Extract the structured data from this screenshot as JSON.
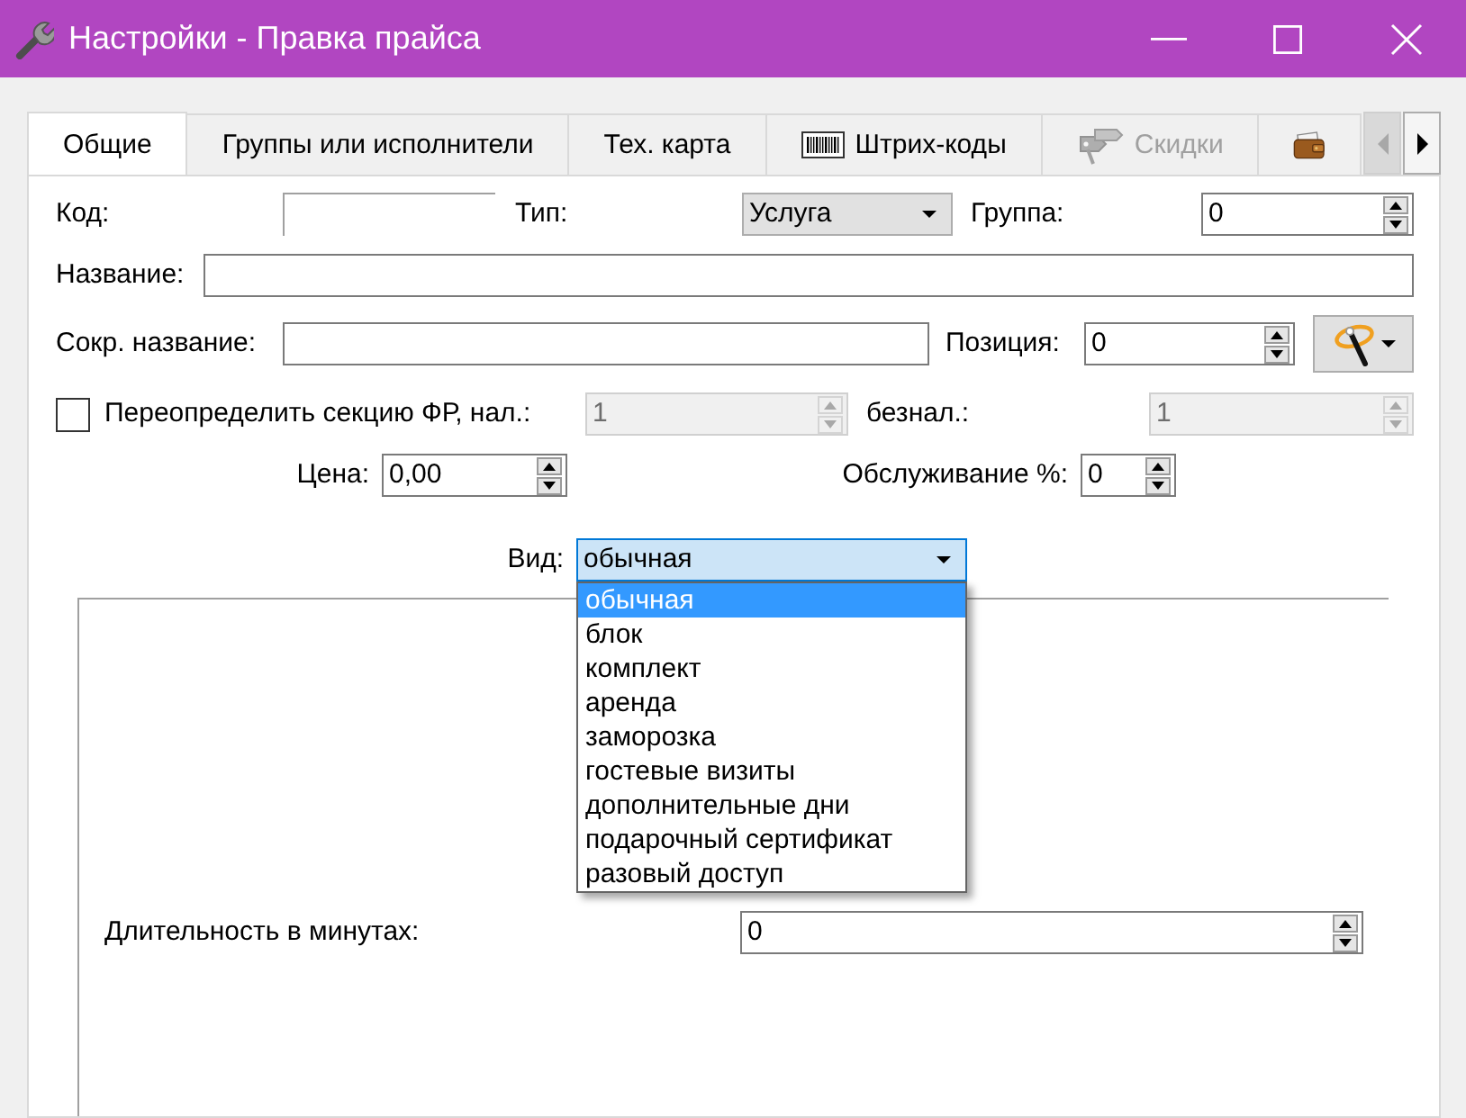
{
  "window": {
    "title": "Настройки - Правка прайса"
  },
  "tabs": [
    {
      "label": "Общие",
      "kind": "text",
      "selected": true,
      "disabled": false
    },
    {
      "label": "Группы или исполнители",
      "kind": "text",
      "selected": false,
      "disabled": false
    },
    {
      "label": "Тех. карта",
      "kind": "text",
      "selected": false,
      "disabled": false
    },
    {
      "label": "Штрих-коды",
      "kind": "barcode",
      "selected": false,
      "disabled": false
    },
    {
      "label": "Скидки",
      "kind": "discount",
      "selected": false,
      "disabled": true
    },
    {
      "kind": "wallet",
      "selected": false,
      "disabled": false
    }
  ],
  "tab_scroll": {
    "back": {
      "disabled": true
    },
    "forward": {
      "disabled": false
    }
  },
  "form": {
    "code": {
      "label": "Код:"
    },
    "type": {
      "label": "Тип:",
      "value": "Услуга"
    },
    "group": {
      "label": "Группа:",
      "value": "0"
    },
    "name": {
      "label": "Название:"
    },
    "short_name": {
      "label": "Сокр. название:"
    },
    "position": {
      "label": "Позиция:",
      "value": "0"
    },
    "override": {
      "label": "Переопределить секцию ФР, нал.:",
      "checked": false
    },
    "cash_section": {
      "value": "1",
      "disabled": true
    },
    "cashless_section": {
      "label": "безнал.:",
      "value": "1",
      "disabled": true
    },
    "price": {
      "label": "Цена:",
      "value": "0,00"
    },
    "service": {
      "label": "Обслуживание %:",
      "value": "0"
    },
    "view_type": {
      "label": "Вид:",
      "value": "обычная",
      "expanded": true,
      "options": [
        {
          "label": "обычная",
          "selected": true
        },
        {
          "label": "блок",
          "selected": false
        },
        {
          "label": "комплект",
          "selected": false
        },
        {
          "label": "аренда",
          "selected": false
        },
        {
          "label": "заморозка",
          "selected": false
        },
        {
          "label": "гостевые визиты",
          "selected": false
        },
        {
          "label": "дополнительные дни",
          "selected": false
        },
        {
          "label": "подарочный сертификат",
          "selected": false
        },
        {
          "label": "разовый доступ",
          "selected": false
        }
      ]
    },
    "duration": {
      "label": "Длительность в минутах:",
      "value": "0"
    }
  }
}
